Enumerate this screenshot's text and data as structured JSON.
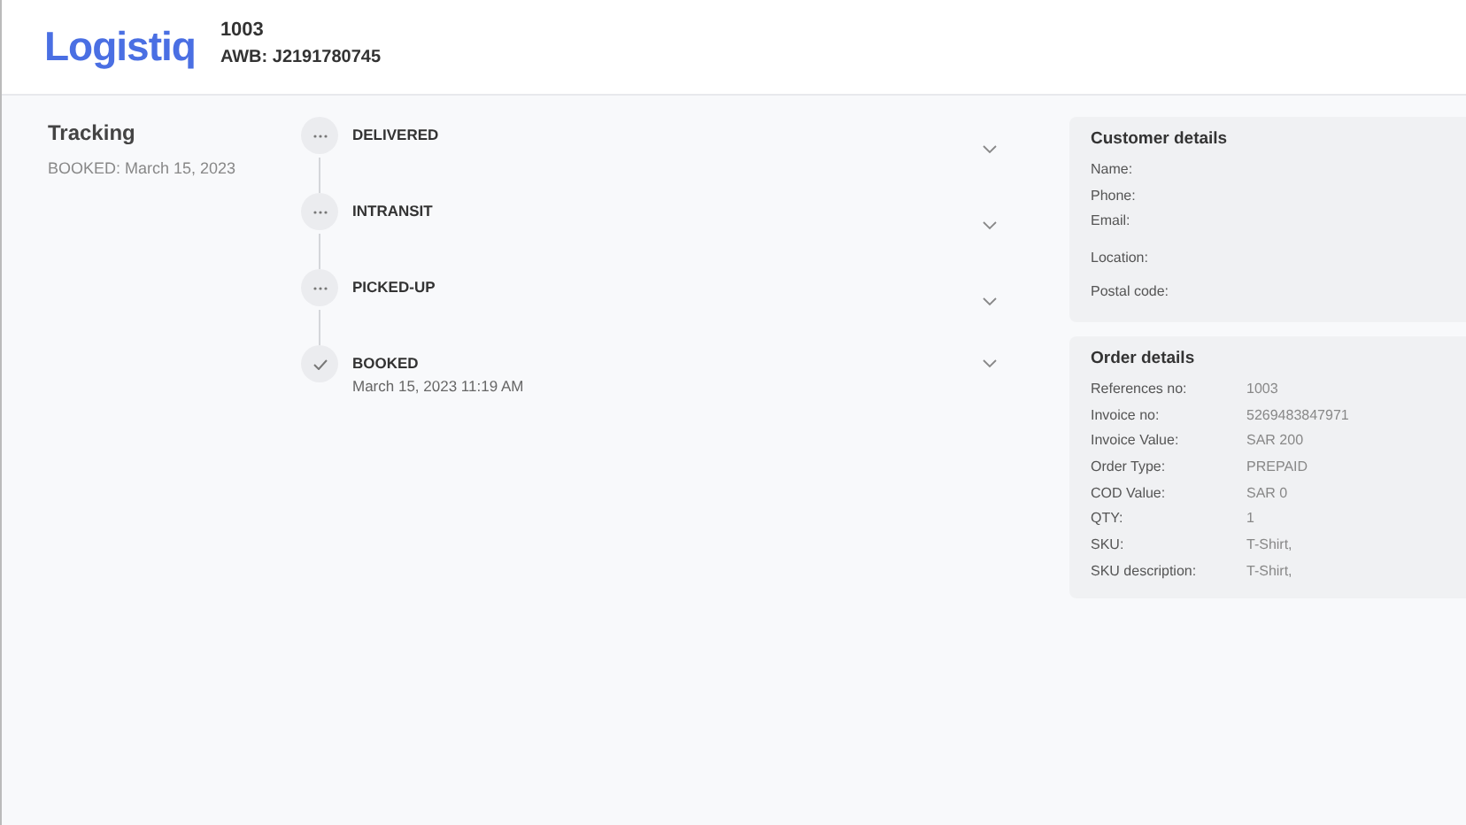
{
  "header": {
    "logo": "Logistiq",
    "order_id": "1003",
    "awb": "AWB: J2191780745"
  },
  "tracking": {
    "title": "Tracking",
    "subtitle": "BOOKED: March 15, 2023",
    "steps": [
      {
        "kind": "pending",
        "title": "DELIVERED"
      },
      {
        "kind": "pending",
        "title": "INTRANSIT"
      },
      {
        "kind": "pending",
        "title": "PICKED-UP"
      },
      {
        "kind": "done",
        "title": "BOOKED",
        "date": "March 15, 2023  11:19 AM"
      }
    ]
  },
  "customer_details": {
    "title": "Customer details",
    "rows": [
      {
        "label": "Name:"
      },
      {
        "label": "Phone:"
      },
      {
        "label": "Email:"
      },
      {
        "label": "Location:"
      },
      {
        "label": "Postal code:"
      }
    ]
  },
  "order_details": {
    "title": "Order details",
    "rows": [
      {
        "label": "References no:",
        "value": "1003"
      },
      {
        "label": "Invoice no:",
        "value": "5269483847971"
      },
      {
        "label": "Invoice Value:",
        "value": "SAR 200"
      },
      {
        "label": "Order Type:",
        "value": "PREPAID"
      },
      {
        "label": "COD Value:",
        "value": "SAR 0"
      },
      {
        "label": "QTY:",
        "value": "1"
      },
      {
        "label": "SKU:",
        "value": "T-Shirt,"
      },
      {
        "label": "SKU description:",
        "value": "T-Shirt,"
      }
    ]
  }
}
